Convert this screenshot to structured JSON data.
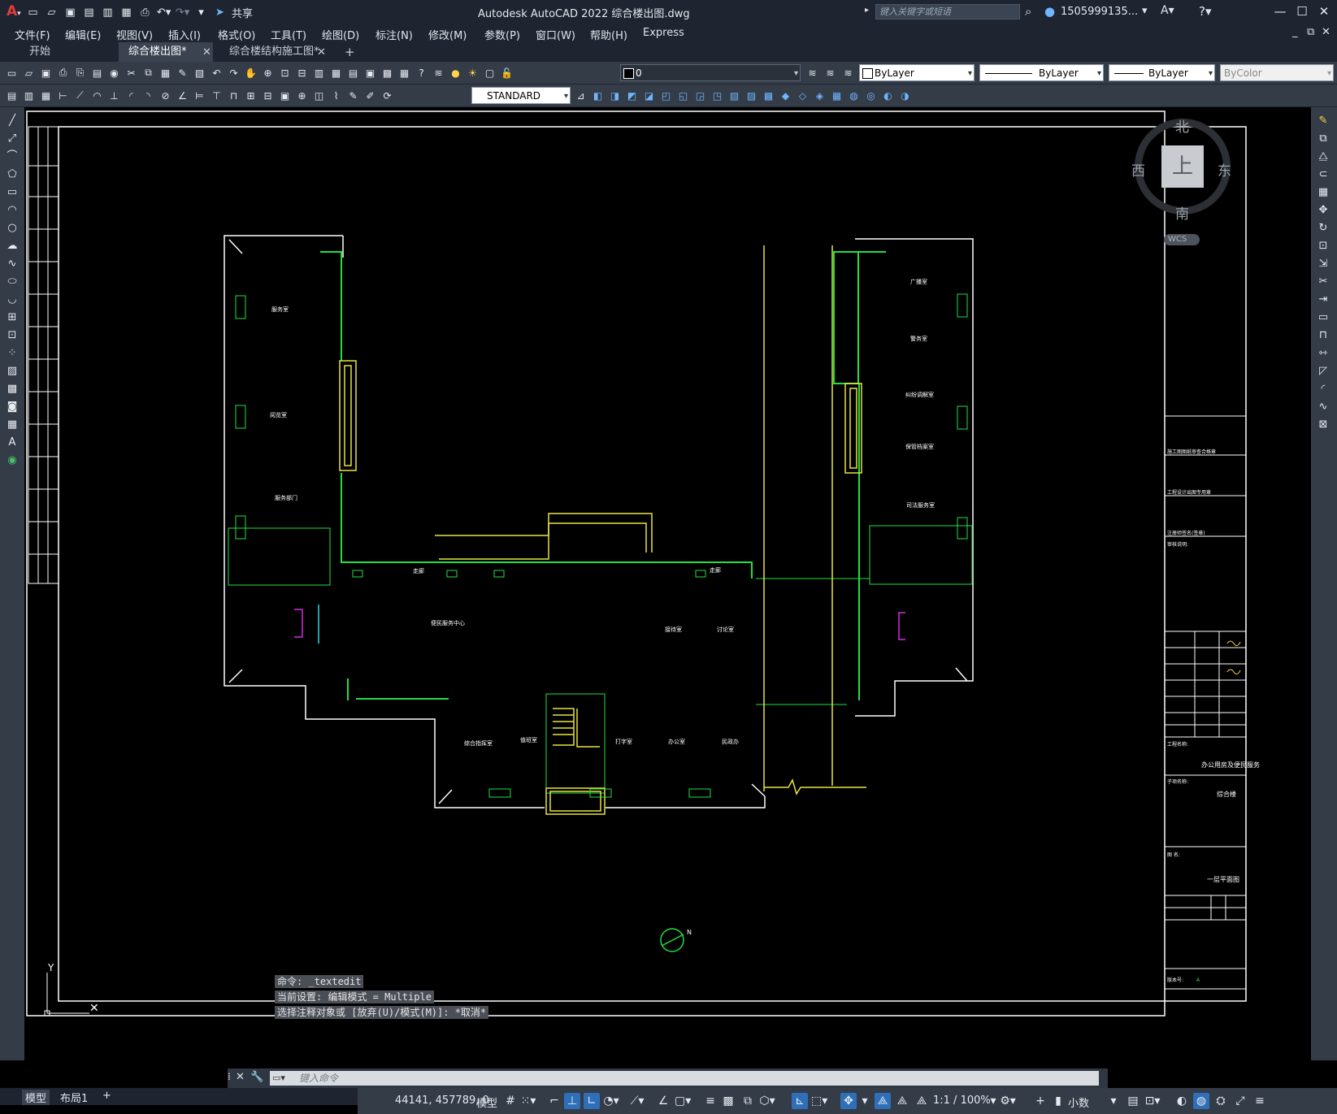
{
  "window": {
    "title": "Autodesk AutoCAD 2022    综合楼出图.dwg",
    "search_placeholder": "键入关键字或短语",
    "user": "1505999135...",
    "share_label": "共享",
    "min": "—",
    "max": "☐",
    "close": "✕"
  },
  "menu": [
    "文件(F)",
    "编辑(E)",
    "视图(V)",
    "插入(I)",
    "格式(O)",
    "工具(T)",
    "绘图(D)",
    "标注(N)",
    "修改(M)",
    "参数(P)",
    "窗口(W)",
    "帮助(H)",
    "Express"
  ],
  "tabs": [
    {
      "label": "开始"
    },
    {
      "label": "综合楼出图*"
    },
    {
      "label": "综合楼结构施工图*"
    }
  ],
  "toolbar": {
    "layer": "0",
    "color": "ByLayer",
    "linetype": "ByLayer",
    "lineweight": "ByLayer",
    "plotstyle": "ByColor",
    "textstyle": "STANDARD"
  },
  "viewcube": {
    "north": "北",
    "south": "南",
    "east": "东",
    "west": "西",
    "top": "上",
    "wcs": "WCS"
  },
  "drawing": {
    "rooms": [
      {
        "id": "r1",
        "text": "服务室"
      },
      {
        "id": "r2",
        "text": "阅览室"
      },
      {
        "id": "r3",
        "text": "服务部门"
      },
      {
        "id": "r4",
        "text": "走廊"
      },
      {
        "id": "r5",
        "text": "走廊"
      },
      {
        "id": "r6",
        "text": "便民服务中心"
      },
      {
        "id": "r7",
        "text": "接待室"
      },
      {
        "id": "r8",
        "text": "讨论室"
      },
      {
        "id": "r9",
        "text": "综合指挥室"
      },
      {
        "id": "r10",
        "text": "值班室"
      },
      {
        "id": "r11",
        "text": "打字室"
      },
      {
        "id": "r12",
        "text": "办公室"
      },
      {
        "id": "r13",
        "text": "民政办"
      },
      {
        "id": "r14",
        "text": "广播室"
      },
      {
        "id": "r15",
        "text": "警务室"
      },
      {
        "id": "r16",
        "text": "纠纷调解室"
      },
      {
        "id": "r17",
        "text": "保管档案室"
      },
      {
        "id": "r18",
        "text": "司法服务室"
      }
    ],
    "titleblock": {
      "project_label": "工程名称:",
      "project_name": "办公用房及便民服务",
      "subitem_label": "子项名称:",
      "subitem_name": "综合楼",
      "drawing_label": "图    名:",
      "drawing_name": "一层平面图",
      "version_label": "版本号:",
      "version": "A",
      "side_labels": [
        "施工图图纸审查合格章",
        "工程设计出图专用章",
        "注册师签名(签章)",
        "审核说明:"
      ]
    }
  },
  "command": {
    "history": [
      "命令: _textedit",
      "当前设置: 编辑模式 = Multiple",
      "选择注释对象或 [放弃(U)/模式(M)]: *取消*"
    ],
    "placeholder": "键入命令"
  },
  "layout_tabs": [
    "模型",
    "布局1"
  ],
  "status": {
    "coords": "44141, 457789, 0",
    "mode": "模型",
    "scale": "1:1 / 100%",
    "units": "小数"
  }
}
